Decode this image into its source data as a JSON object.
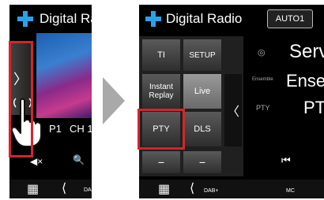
{
  "left_screen": {
    "title": "Digital Ra",
    "preset": "P1",
    "channel": "CH 1",
    "mute_icon_text": "◀×",
    "search_icon_text": "🔍",
    "grid_icon_text": "▦",
    "back_icon_text": "⟨",
    "dab_text": "DA",
    "tab_arrow_text": "〉"
  },
  "arrow_text": "▶",
  "right_screen": {
    "title": "Digital Radio",
    "auto_button": "AUTO1",
    "menu": {
      "ti": "TI",
      "setup": "SETUP",
      "instant_replay_line1": "Instant",
      "instant_replay_line2": "Replay",
      "live": "Live",
      "pty": "PTY",
      "dls": "DLS",
      "collapse_arrow": "〈"
    },
    "info": {
      "service_text": "Serv",
      "ensemble_label": "Ensemble",
      "ensemble_text": "Ense",
      "pty_label": "PTY",
      "pty_value": "PT",
      "service_icon": "◎"
    },
    "bottom": {
      "grid_icon_text": "▦",
      "back_icon_text": "⟨",
      "dab_label": "DAB+",
      "mc_label": "MC",
      "prev_icon_text": "⏮",
      "minus1": "−",
      "minus2": "−"
    }
  }
}
